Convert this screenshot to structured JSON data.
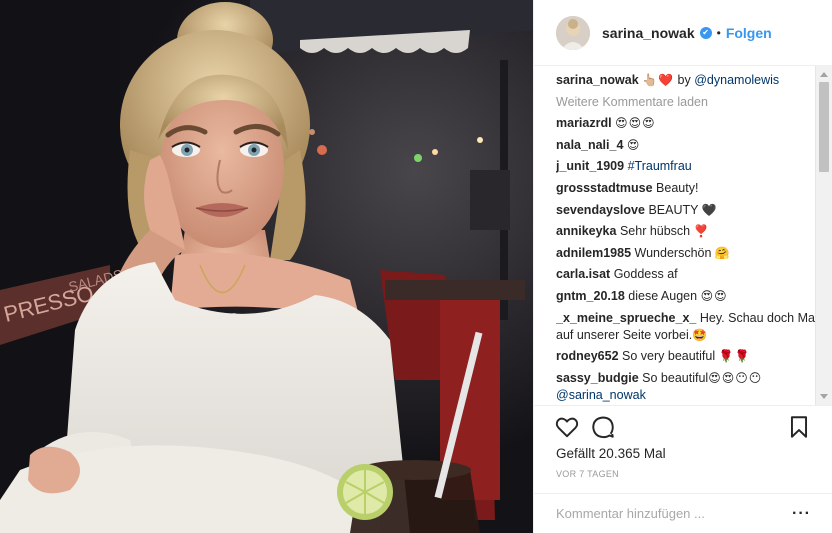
{
  "header": {
    "username": "sarina_nowak",
    "verified_mark": "✔",
    "separator": "•",
    "follow_label": "Folgen"
  },
  "caption": {
    "username": "sarina_nowak",
    "emoji": "👆🏼❤️",
    "by_text": "by",
    "mention": "@dynamolewis"
  },
  "load_more_label": "Weitere Kommentare laden",
  "comments": [
    {
      "user": "mariazrdl",
      "text": "",
      "emoji": "😍😍😍"
    },
    {
      "user": "nala_nali_4",
      "text": "",
      "emoji": "😍"
    },
    {
      "user": "j_unit_1909",
      "text": "",
      "tag": "#Traumfrau"
    },
    {
      "user": "grossstadtmuse",
      "text": "Beauty!"
    },
    {
      "user": "sevendayslove",
      "text": "BEAUTY",
      "emoji": "🖤"
    },
    {
      "user": "annikeyka",
      "text": "Sehr hübsch",
      "emoji": "❣️"
    },
    {
      "user": "adnilem1985",
      "text": "Wunderschön",
      "emoji": "🤗"
    },
    {
      "user": "carla.isat",
      "text": "Goddess af"
    },
    {
      "user": "gntm_20.18",
      "text": "diese Augen",
      "emoji": "😍😍"
    },
    {
      "user": "_x_meine_sprueche_x_",
      "text": "Hey. Schau doch Mal auf unserer Seite vorbei.",
      "emoji": "🤩"
    },
    {
      "user": "rodney652",
      "text": "So very beautiful",
      "emoji": "🌹🌹"
    },
    {
      "user": "sassy_budgie",
      "text": "So beautiful",
      "emoji": "😍😍😶😶",
      "tag": "@sarina_nowak"
    }
  ],
  "actions": {
    "like_icon": "heart-icon",
    "comment_icon": "comment-icon",
    "save_icon": "bookmark-icon",
    "likes_label": "Gefällt",
    "likes_count": "20.365 Mal",
    "timestamp": "VOR 7 TAGEN"
  },
  "add_comment": {
    "placeholder": "Kommentar hinzufügen ...",
    "more_label": "···"
  },
  "colors": {
    "accent": "#3897f0",
    "text": "#262626",
    "muted": "#999999",
    "border": "#efefef"
  }
}
